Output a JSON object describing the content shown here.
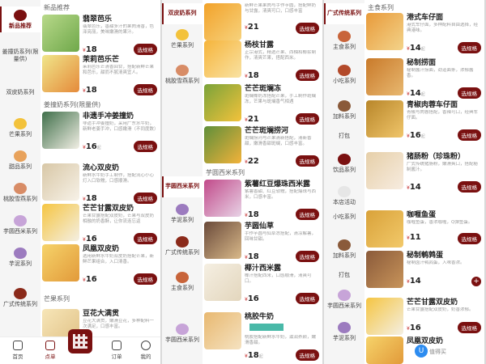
{
  "colors": {
    "brand": "#7a1010",
    "price": "#c12020",
    "accent_bar": "#49b9a8"
  },
  "currency": "¥",
  "unit_suffix": "起",
  "spec_button": "选规格",
  "panel1": {
    "categories": [
      {
        "label": "新品推荐",
        "active": true
      },
      {
        "label": "姜撞奶系列(限量供)"
      },
      {
        "label": "双皮奶系列"
      },
      {
        "label": "芒果系列"
      },
      {
        "label": "甜品系列"
      },
      {
        "label": "桃胶雪燕系列"
      },
      {
        "label": "芋圆西米系列"
      },
      {
        "label": "芋泥系列"
      },
      {
        "label": "广式传统系列"
      }
    ],
    "sections": [
      "新品推荐",
      "姜撞奶系列(限量供)",
      "芒果系列"
    ],
    "items": [
      {
        "name": "翡翠芭乐",
        "desc": "翡翠芭乐，香甜多汁的果肉清香，色泽亮丽，美味嫩滑的果汁。",
        "price": "18",
        "suffix": "",
        "action": "spec"
      },
      {
        "name": "茉莉芭乐芒",
        "desc": "茉莉芭乐芒清香回甘，搭配新鲜芒果和芭乐，甜而不腻清爽宜人。",
        "price": "18",
        "suffix": "",
        "action": "spec"
      },
      {
        "name": "非遗手冲姜撞奶",
        "desc": "非遗手冲姜撞奶，采用广东水牛奶，新鲜老姜手冲，口感嫩滑（不同度数）",
        "price": "16",
        "suffix": "起",
        "action": "spec"
      },
      {
        "name": "流心双皮奶",
        "desc": "新鲜水牛奶手工制作，搭配流心小心灯入口软糯，口感顺滑。",
        "price": "18",
        "suffix": "",
        "action": "spec"
      },
      {
        "name": "芒芒甘露双皮奶",
        "desc": "芒果甘露搭配双皮奶，芒果与双皮奶相融的奶香酥，让你流连忘返",
        "price": "16",
        "suffix": "",
        "action": "spec"
      },
      {
        "name": "凤凰双皮奶",
        "desc": "选用新鲜水牛奶双皮奶搭配芒果，新鲜芒果组合，入口清香。",
        "price": "16",
        "suffix": "",
        "action": "spec"
      },
      {
        "name": "豆花大满贯",
        "desc": "豆花大满贯，嫩滑豆花，多种配料一次满足，口感丰富。",
        "price": "",
        "suffix": "",
        "action": "none"
      }
    ],
    "tabbar": [
      {
        "label": "首页",
        "active": false
      },
      {
        "label": "点单",
        "active": true
      },
      {
        "label": "订单",
        "active": false
      },
      {
        "label": "我的",
        "active": false
      }
    ]
  },
  "panel2": {
    "categories": [
      {
        "label": "双皮奶系列",
        "active": true
      },
      {
        "label": "芒果系列"
      },
      {
        "label": "桃胶雪燕系列"
      },
      {
        "label": "芋圆西米系列",
        "active": true
      },
      {
        "label": "芋泥系列"
      },
      {
        "label": "广式传统系列"
      },
      {
        "label": "主食系列"
      },
      {
        "label": "芋圆西米系列"
      }
    ],
    "sections": [
      "芋圆西米系列"
    ],
    "items": [
      {
        "name": "",
        "desc": "新鲜芒果果肉与手作芋圆，搭配鲜奶与甘露，清爽可口，口感丰富",
        "price": "21",
        "suffix": "",
        "action": "spec"
      },
      {
        "name": "杨枝甘露",
        "desc": "正宗港式，精选芒果、西柚和椰浆制作，清爽芒果，搭配西米。",
        "price": "18",
        "suffix": "",
        "action": "spec"
      },
      {
        "name": "芒芒斑斓冻",
        "desc": "斑斓椰奶冻搭配芒果，手工制作斑斓冻，芒果与斑斓香气相遇",
        "price": "21",
        "suffix": "",
        "action": "spec"
      },
      {
        "name": "芒芒斑斓捞河",
        "desc": "斑斓捞河与芒果清新搭配，清新香甜，嫩滑香甜斑斓，口感丰富。",
        "price": "22",
        "suffix": "",
        "action": "spec"
      },
      {
        "name": "紫薯红豆爆珠西米露",
        "desc": "紫薯香甜、红豆软糯，搭配爆珠与西米，口感丰富。",
        "price": "18",
        "suffix": "",
        "action": "spec"
      },
      {
        "name": "芋圆仙草",
        "desc": "手作芋圆与仙草冻搭配，清凉解暑，回味甘甜。",
        "price": "18",
        "suffix": "",
        "action": "spec"
      },
      {
        "name": "椰汁西米露",
        "desc": "椰汁搭配西米，口感顺滑，清爽可口。",
        "price": "16",
        "suffix": "",
        "action": "spec"
      },
      {
        "name": "桃胶牛奶",
        "desc": "桃胶搭配新鲜水牛奶，滋润养颜，嫩滑香甜。",
        "price": "18",
        "suffix": "起",
        "action": "spec"
      }
    ]
  },
  "panel3": {
    "categories": [
      {
        "label": "广式传统系列",
        "active": true
      },
      {
        "label": "主食系列"
      },
      {
        "label": "小吃系列"
      },
      {
        "label": "加料系列"
      },
      {
        "label": "打包"
      },
      {
        "label": "饮品系列"
      },
      {
        "label": "本店活动"
      },
      {
        "label": "小吃系列"
      },
      {
        "label": "加料系列"
      },
      {
        "label": "打包"
      },
      {
        "label": "芋圆西米系列"
      },
      {
        "label": "芋泥系列"
      }
    ],
    "sections": [
      "主食系列"
    ],
    "items": [
      {
        "name": "港式车仔面",
        "desc": "港式车仔面，多种配料自由选择，经典港味。",
        "price": "14",
        "suffix": "起",
        "action": "spec"
      },
      {
        "name": "秘制捞面",
        "desc": "秘制酱汁捞面，劲道面条，浓郁酱香。",
        "price": "14",
        "suffix": "起",
        "action": "spec"
      },
      {
        "name": "青椒肉蓉车仔面",
        "desc": "青椒与肉蓉搭配，香辣可口，经典车仔面。",
        "price": "16",
        "suffix": "起",
        "action": "spec"
      },
      {
        "name": "猪肠粉（珍珠粉）",
        "desc": "广式传统猪肠粉，嫩滑爽口，搭配秘制酱汁。",
        "price": "14",
        "suffix": "",
        "action": "spec"
      },
      {
        "name": "咖喱鱼蛋",
        "desc": "咖喱鱼蛋，香浓咖喱，Q弹鱼蛋。",
        "price": "11",
        "suffix": "",
        "action": "spec"
      },
      {
        "name": "秘制鹌鹑蛋",
        "desc": "秘制卤汁鹌鹑蛋，入味香浓。",
        "price": "14",
        "suffix": "",
        "action": "plus"
      },
      {
        "name": "芒芒甘露双皮奶",
        "desc": "芒果甘露搭配双皮奶，奶香浓郁。",
        "price": "16",
        "suffix": "",
        "action": "spec"
      },
      {
        "name": "凤凰双皮奶",
        "desc": "",
        "price": "",
        "suffix": "",
        "action": "none"
      }
    ],
    "watermark": "值得买"
  }
}
